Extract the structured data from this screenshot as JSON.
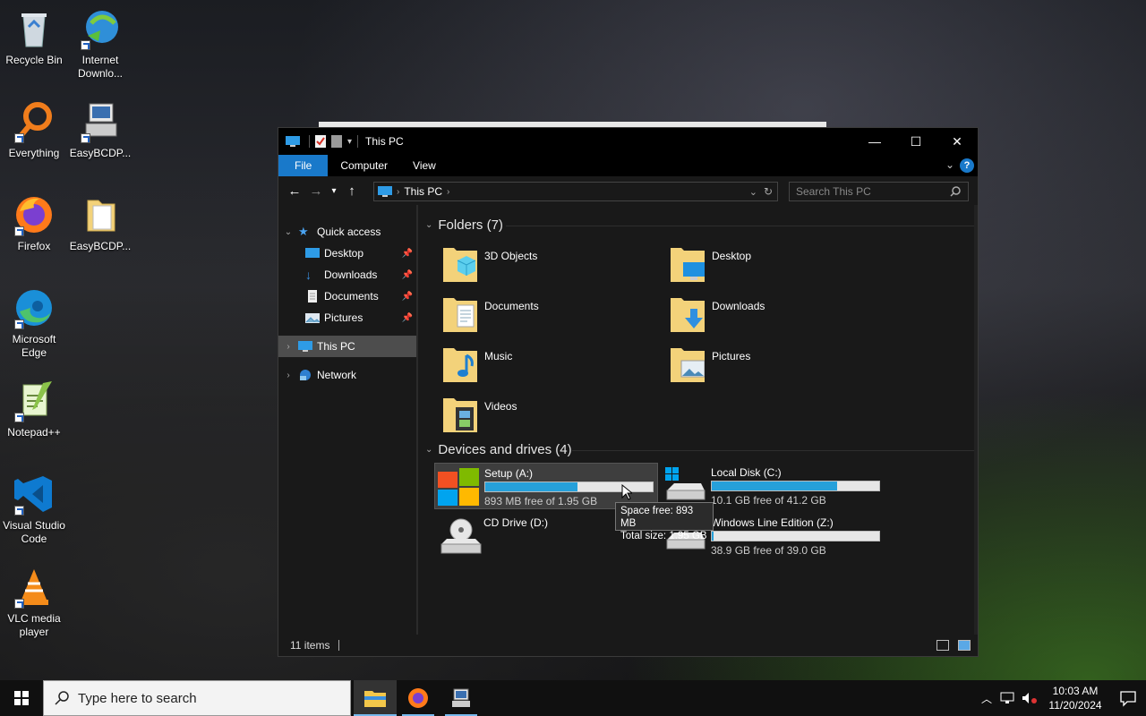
{
  "desktop": {
    "icons": [
      {
        "label": "Recycle Bin",
        "icon": "recycle-bin-icon"
      },
      {
        "label": "Internet Downlo...",
        "icon": "internet-download-manager-icon"
      },
      {
        "label": "Everything",
        "icon": "everything-search-icon"
      },
      {
        "label": "EasyBCDP...",
        "icon": "easybcd-icon"
      },
      {
        "label": "Firefox",
        "icon": "firefox-icon"
      },
      {
        "label": "EasyBCDP...",
        "icon": "folder-icon"
      },
      {
        "label": "Microsoft Edge",
        "icon": "edge-icon"
      },
      {
        "label": "Notepad++",
        "icon": "notepadpp-icon"
      },
      {
        "label": "Visual Studio Code",
        "icon": "vscode-icon"
      },
      {
        "label": "VLC media player",
        "icon": "vlc-icon"
      }
    ]
  },
  "window": {
    "title": "This PC",
    "ribbon_tabs": [
      "File",
      "Computer",
      "View"
    ],
    "address": {
      "location": "This PC"
    },
    "search_placeholder": "Search This PC",
    "nav": {
      "quick_access": "Quick access",
      "quick_items": [
        "Desktop",
        "Downloads",
        "Documents",
        "Pictures"
      ],
      "this_pc": "This PC",
      "network": "Network"
    },
    "folders_header": "Folders (7)",
    "folders": [
      {
        "name": "3D Objects",
        "overlay": "3d-cube-icon"
      },
      {
        "name": "Desktop",
        "overlay": "desktop-monitor-icon"
      },
      {
        "name": "Documents",
        "overlay": "document-icon"
      },
      {
        "name": "Downloads",
        "overlay": "download-arrow-icon"
      },
      {
        "name": "Music",
        "overlay": "music-note-icon"
      },
      {
        "name": "Pictures",
        "overlay": "picture-icon"
      },
      {
        "name": "Videos",
        "overlay": "film-icon"
      }
    ],
    "drives_header": "Devices and drives (4)",
    "drives": [
      {
        "name": "Setup (A:)",
        "free": "893 MB free of 1.95 GB",
        "used_fraction": 0.55
      },
      {
        "name": "Local Disk (C:)",
        "free": "10.1 GB free of 41.2 GB",
        "used_fraction": 0.75
      },
      {
        "name": "CD Drive (D:)",
        "free": "",
        "used_fraction": null
      },
      {
        "name": "Windows Line Edition (Z:)",
        "free": "38.9 GB free of 39.0 GB",
        "used_fraction": 0.01
      }
    ],
    "tooltip": {
      "line1": "Space free: 893 MB",
      "line2": "Total size: 1.95 GB"
    },
    "status": "11 items"
  },
  "taskbar": {
    "search_placeholder": "Type here to search",
    "time": "10:03 AM",
    "date": "11/20/2024"
  },
  "colors": {
    "accent": "#1979ca",
    "drive_bar": "#26a0da"
  }
}
